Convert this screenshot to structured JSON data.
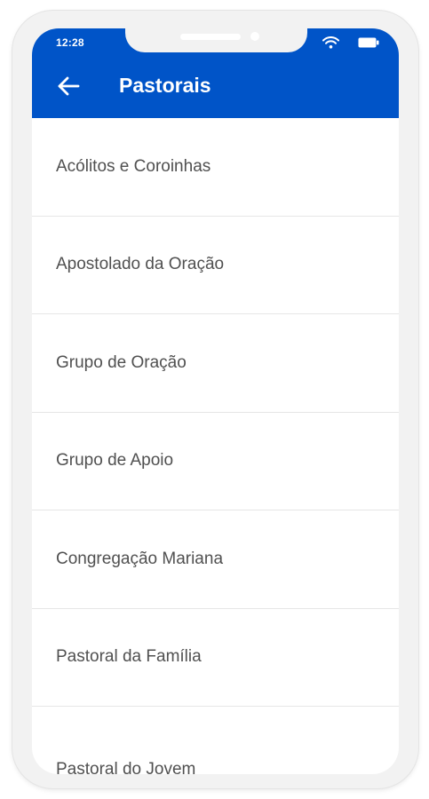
{
  "status_bar": {
    "time": "12:28",
    "icons": [
      "wifi-icon",
      "battery-icon"
    ]
  },
  "header": {
    "back_icon": "arrow-left-icon",
    "title": "Pastorais"
  },
  "list": {
    "items": [
      {
        "label": "Acólitos e Coroinhas"
      },
      {
        "label": "Apostolado da Oração"
      },
      {
        "label": "Grupo de Oração"
      },
      {
        "label": "Grupo de Apoio"
      },
      {
        "label": "Congregação Mariana"
      },
      {
        "label": "Pastoral da Família"
      },
      {
        "label": "Pastoral do Jovem"
      }
    ]
  },
  "colors": {
    "app_bar": "#0054c8",
    "text": "#505050",
    "divider": "#e6e6e6"
  }
}
